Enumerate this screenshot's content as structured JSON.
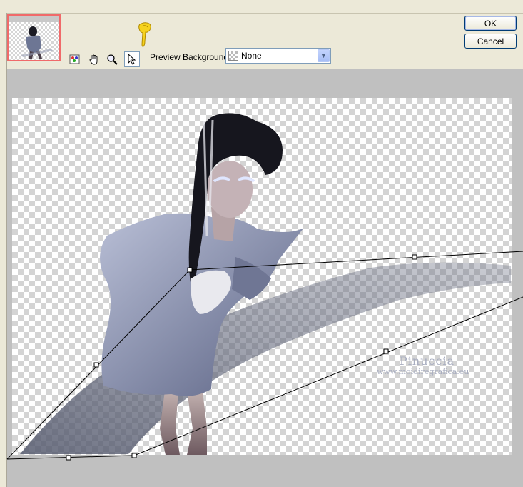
{
  "toolbar": {
    "tools": [
      {
        "name": "navigator-tool",
        "icon": "palette-icon"
      },
      {
        "name": "pan-tool",
        "icon": "hand-icon"
      },
      {
        "name": "zoom-tool",
        "icon": "magnifier-icon"
      },
      {
        "name": "arrow-tool",
        "icon": "arrow-pointer-icon",
        "active": true
      }
    ],
    "preview_background_label": "Preview Background:",
    "preview_background_value": "None"
  },
  "buttons": {
    "ok_label": "OK",
    "cancel_label": "Cancel"
  },
  "watermark": {
    "line1": "Pinuccia",
    "line2": "www.moidiregrafica.eu"
  },
  "colors": {
    "dialog_bg": "#ece9d8",
    "thumbnail_border": "#f06a6a",
    "preview_frame": "#c0c0c0"
  }
}
